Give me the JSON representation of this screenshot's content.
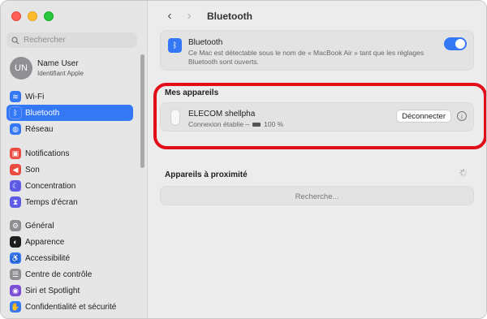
{
  "sidebar": {
    "search_placeholder": "Rechercher",
    "user": {
      "initials": "UN",
      "name": "Name User",
      "subtitle": "Identifiant Apple"
    },
    "groups": [
      [
        {
          "label": "Wi-Fi",
          "icon": "wifi-icon",
          "color": "#3478f6",
          "glyph": "≋",
          "active": false
        },
        {
          "label": "Bluetooth",
          "icon": "bluetooth-icon",
          "color": "#3478f6",
          "glyph": "ᛒ",
          "active": true
        },
        {
          "label": "Réseau",
          "icon": "globe-icon",
          "color": "#3478f6",
          "glyph": "◍",
          "active": false
        }
      ],
      [
        {
          "label": "Notifications",
          "icon": "notifications-icon",
          "color": "#ea4a3f",
          "glyph": "▣",
          "active": false
        },
        {
          "label": "Son",
          "icon": "speaker-icon",
          "color": "#ea4a3f",
          "glyph": "◀",
          "active": false
        },
        {
          "label": "Concentration",
          "icon": "moon-icon",
          "color": "#5e5ce6",
          "glyph": "☾",
          "active": false
        },
        {
          "label": "Temps d'écran",
          "icon": "hourglass-icon",
          "color": "#5e5ce6",
          "glyph": "⧗",
          "active": false
        }
      ],
      [
        {
          "label": "Général",
          "icon": "gear-icon",
          "color": "#8e8e93",
          "glyph": "⚙",
          "active": false
        },
        {
          "label": "Apparence",
          "icon": "appearance-icon",
          "color": "#1d1d1f",
          "glyph": "◐",
          "active": false
        },
        {
          "label": "Accessibilité",
          "icon": "accessibility-icon",
          "color": "#3478f6",
          "glyph": "♿",
          "active": false
        },
        {
          "label": "Centre de contrôle",
          "icon": "control-center-icon",
          "color": "#8e8e93",
          "glyph": "☰",
          "active": false
        },
        {
          "label": "Siri et Spotlight",
          "icon": "siri-icon",
          "color": "#7a4fd6",
          "glyph": "◉",
          "active": false
        },
        {
          "label": "Confidentialité et sécurité",
          "icon": "privacy-hand-icon",
          "color": "#3478f6",
          "glyph": "✋",
          "active": false
        }
      ]
    ]
  },
  "toolbar": {
    "back_glyph": "‹",
    "forward_glyph": "›",
    "title": "Bluetooth"
  },
  "bluetooth": {
    "title": "Bluetooth",
    "description": "Ce Mac est détectable sous le nom de « MacBook Air » tant que les réglages Bluetooth sont ouverts.",
    "enabled": true
  },
  "my_devices": {
    "title": "Mes appareils",
    "devices": [
      {
        "name": "ELECOM shellpha",
        "status": "Connexion établie –",
        "battery": "100 %",
        "battery_level": 1.0,
        "action_label": "Déconnecter",
        "info_glyph": "i"
      }
    ]
  },
  "nearby": {
    "title": "Appareils à proximité",
    "status": "Recherche..."
  },
  "colors": {
    "accent": "#3478f6",
    "highlight": "#e10d19"
  }
}
